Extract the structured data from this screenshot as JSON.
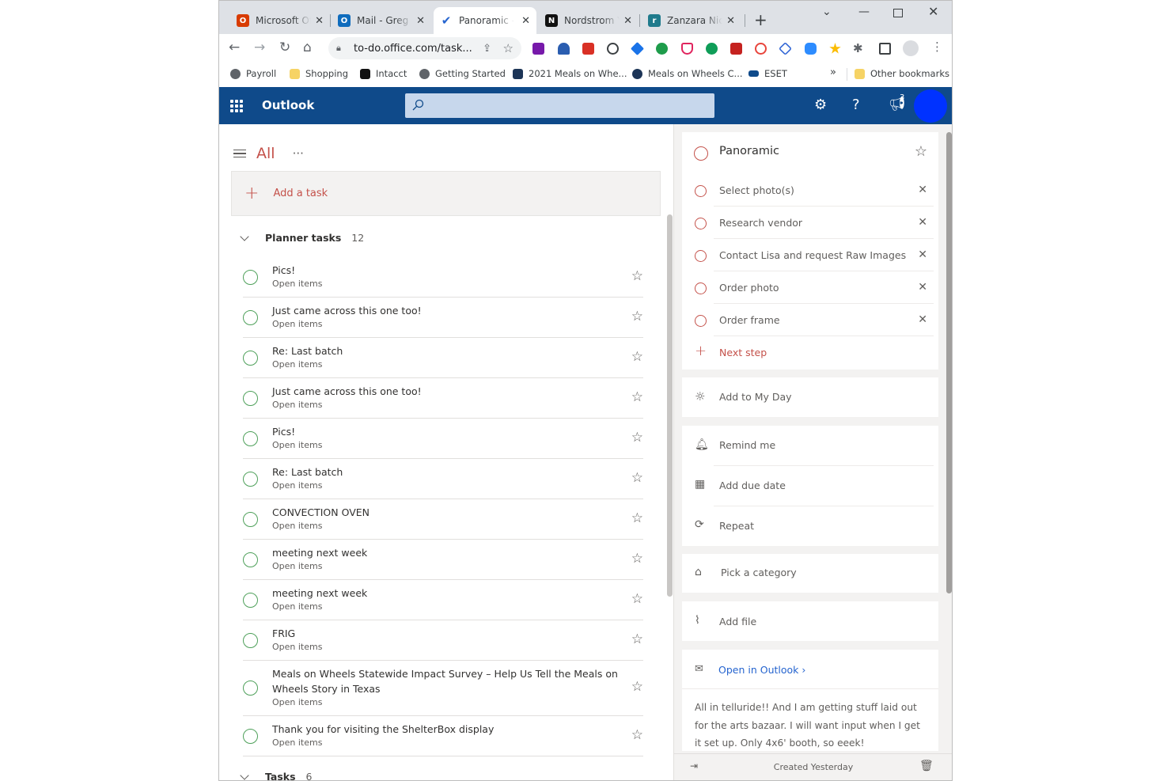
{
  "browser": {
    "tabs": [
      {
        "title": "Microsoft Office Home",
        "favicon": "office-icon",
        "color": "#d83b01",
        "active": false
      },
      {
        "title": "Mail - Greg P",
        "favicon": "outlook-icon",
        "color": "#0f6cbd",
        "active": false
      },
      {
        "title": "Panoramic - To Do",
        "favicon": "todo-check-icon",
        "color": "#2564cf",
        "active": true
      },
      {
        "title": "Nordstrom Y",
        "favicon": "nordstrom-n-icon",
        "color": "#111111",
        "active": false
      },
      {
        "title": "Zanzara Nick",
        "favicon": "zanzara-r-icon",
        "color": "#1f7a8c",
        "active": false
      }
    ],
    "url": "to-do.office.com/task...",
    "bookmarks": [
      {
        "label": "Payroll",
        "icon": "globe-icon",
        "color": "#5f6368"
      },
      {
        "label": "Shopping",
        "icon": "folder-icon",
        "color": "#f6d365"
      },
      {
        "label": "Intacct",
        "icon": "intacct-icon",
        "color": "#111111"
      },
      {
        "label": "Getting Started",
        "icon": "globe-icon",
        "color": "#5f6368"
      },
      {
        "label": "2021 Meals on Whe...",
        "icon": "meals-icon",
        "color": "#1d3557"
      },
      {
        "label": "Meals on Wheels C...",
        "icon": "meals-circle-icon",
        "color": "#1d3557"
      },
      {
        "label": "ESET",
        "icon": "eset-icon",
        "color": "#0f4a8a"
      }
    ],
    "bookmarks_overflow": "»",
    "other_bookmarks": "Other bookmarks"
  },
  "outlook": {
    "brand": "Outlook",
    "notification_count": "3",
    "avatar_color": "#0032ff",
    "header_color": "#0f4a8a"
  },
  "list": {
    "title": "All",
    "more": "···",
    "add_task": "Add a task",
    "groups": [
      {
        "name": "Planner tasks",
        "count": "12"
      },
      {
        "name": "Tasks",
        "count": "6"
      }
    ],
    "tasks": [
      {
        "title": "Pics!",
        "sub": "Open items"
      },
      {
        "title": "Just came across this one too!",
        "sub": "Open items"
      },
      {
        "title": "Re: Last batch",
        "sub": "Open items"
      },
      {
        "title": "Just came across this one too!",
        "sub": "Open items"
      },
      {
        "title": "Pics!",
        "sub": "Open items"
      },
      {
        "title": "Re: Last batch",
        "sub": "Open items"
      },
      {
        "title": "CONVECTION OVEN",
        "sub": "Open items"
      },
      {
        "title": "meeting next week",
        "sub": "Open items"
      },
      {
        "title": "meeting next week",
        "sub": "Open items"
      },
      {
        "title": "FRIG",
        "sub": "Open items"
      },
      {
        "title": "Meals on Wheels Statewide Impact Survey – Help Us Tell the Meals on Wheels Story in Texas",
        "sub": "Open items"
      },
      {
        "title": "Thank you for visiting the ShelterBox display",
        "sub": "Open items"
      }
    ],
    "accent": "#c4514a",
    "circle_color": "#4ea05a"
  },
  "detail": {
    "title": "Panoramic",
    "steps": [
      "Select photo(s)",
      "Research vendor",
      "Contact Lisa and request Raw Images",
      "Order photo",
      "Order frame"
    ],
    "next_step": "Next step",
    "my_day": "Add to My Day",
    "remind": "Remind me",
    "due": "Add due date",
    "repeat": "Repeat",
    "category": "Pick a category",
    "file": "Add file",
    "open_outlook": "Open in Outlook",
    "note": "All in telluride!! And I am getting stuff laid out for the arts bazaar. I will want input when I get it set up. Only 4x6' booth, so eeek!",
    "created": "Created Yesterday"
  }
}
